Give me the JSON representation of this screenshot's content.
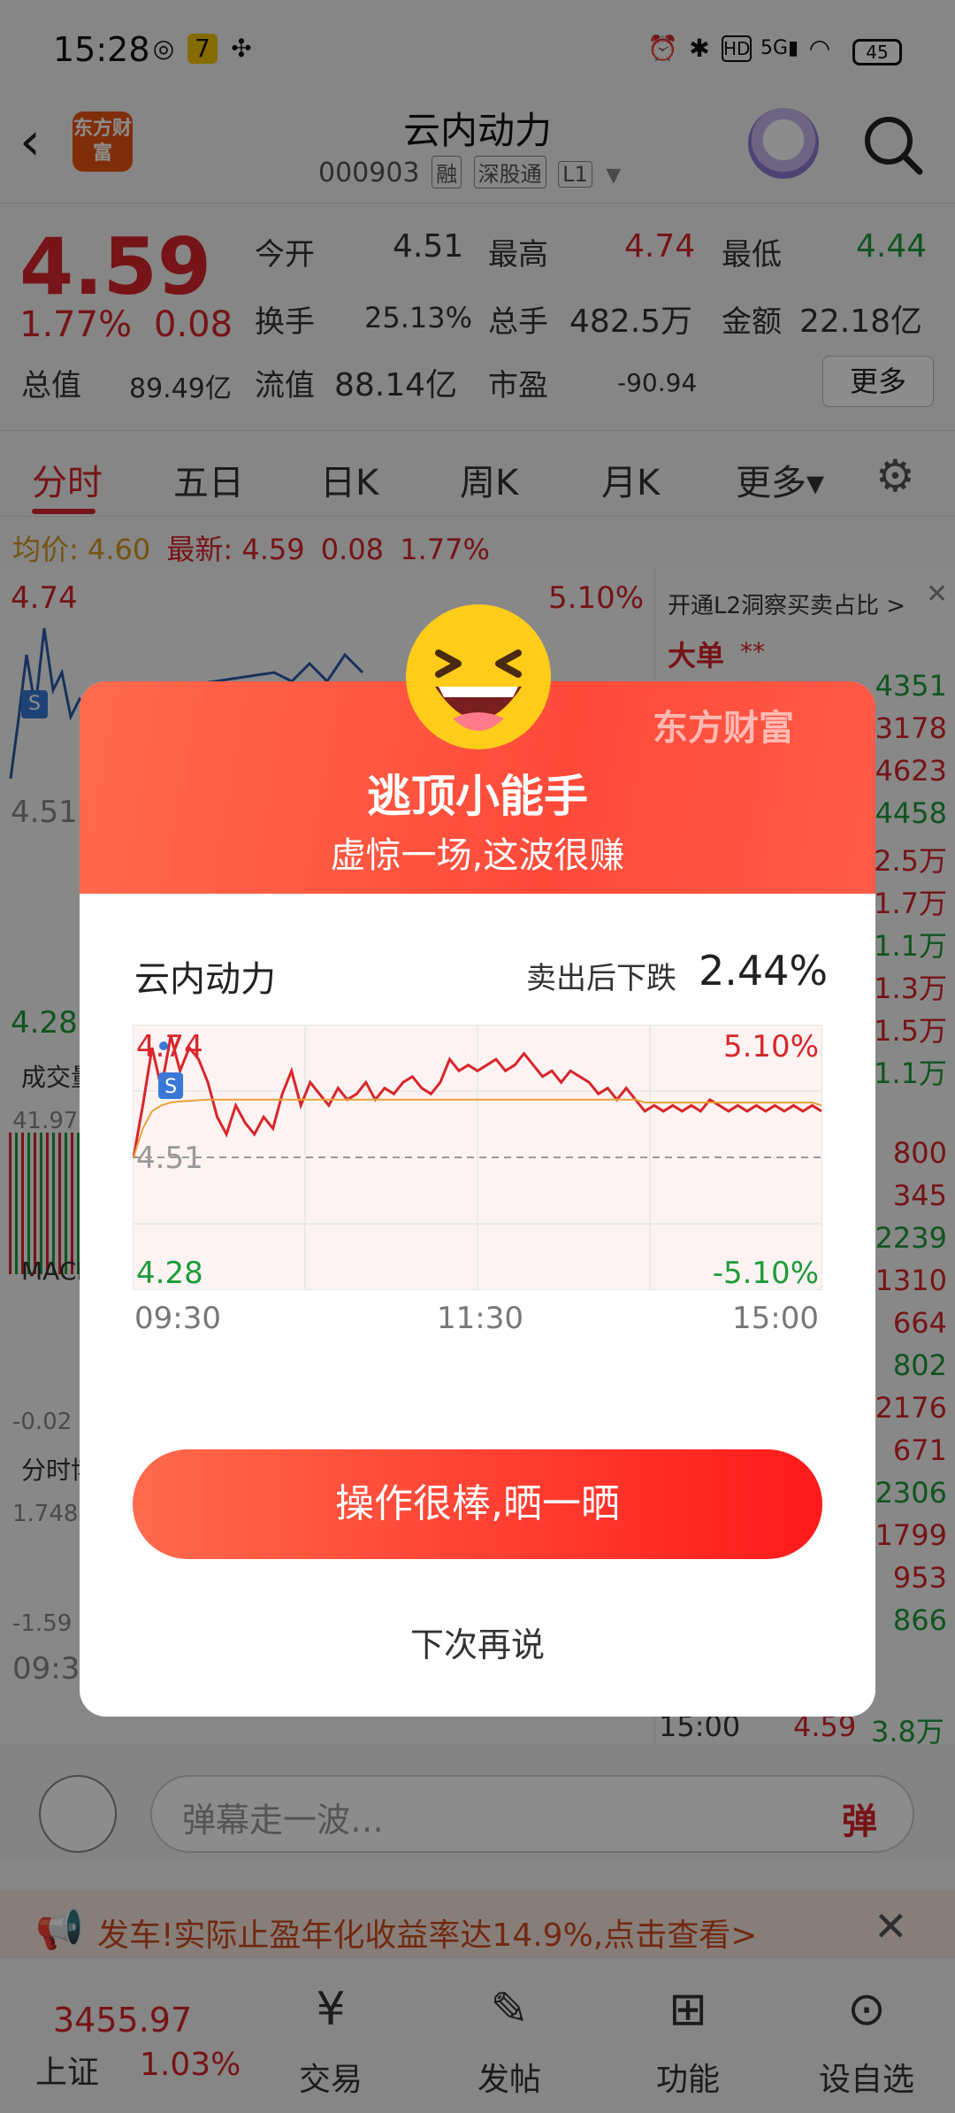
{
  "status_bar": {
    "time": "15:28",
    "battery": "45"
  },
  "header": {
    "logo_text": "东方财富",
    "name": "云内动力",
    "code": "000903",
    "tags": [
      "融",
      "深股通",
      "L1"
    ]
  },
  "quote": {
    "price": "4.59",
    "change_pct": "1.77%",
    "change": "0.08",
    "fields": [
      {
        "label": "今开",
        "value": "4.51",
        "color": "#333333"
      },
      {
        "label": "最高",
        "value": "4.74",
        "color": "#d8262a"
      },
      {
        "label": "最低",
        "value": "4.44",
        "color": "#1e9b3a"
      },
      {
        "label": "换手",
        "value": "25.13%",
        "color": "#333333"
      },
      {
        "label": "总手",
        "value": "482.5万",
        "color": "#333333"
      },
      {
        "label": "金额",
        "value": "22.18亿",
        "color": "#333333"
      },
      {
        "label": "总值",
        "value": "89.49亿",
        "color": "#333333"
      },
      {
        "label": "流值",
        "value": "88.14亿",
        "color": "#333333"
      },
      {
        "label": "市盈",
        "value": "-90.94",
        "color": "#333333"
      }
    ],
    "more_label": "更多"
  },
  "tabs": [
    "分时",
    "五日",
    "日K",
    "周K",
    "月K",
    "更多▾"
  ],
  "avg_line": {
    "avg_label": "均价:",
    "avg": "4.60",
    "last_label": "最新:",
    "last": "4.59",
    "chg": "0.08",
    "pct": "1.77%"
  },
  "background": {
    "chart_top_left": "4.74",
    "chart_top_right": "5.10%",
    "chart_mid": "4.51",
    "chart_bottom": "4.28",
    "panel_labels": [
      "成交量",
      "41.97",
      "MACD",
      "-0.02",
      "分时博弈",
      "1.748",
      "-1.59",
      "09:3"
    ],
    "l2_text": "开通L2洞察买卖占比 >",
    "big_order_label": "大单",
    "big_order_value": "**",
    "right_numbers": [
      "4351",
      "3178",
      "4623",
      "4458",
      "2.5万",
      "1.7万",
      "1.1万",
      "1.3万",
      "1.5万",
      "1.1万",
      "800",
      "345",
      "2239",
      "1310",
      "664",
      "802",
      "2176",
      "671",
      "2306",
      "1799",
      "953",
      "866"
    ],
    "last_row": {
      "time": "15:00",
      "price": "4.59",
      "vol": "3.8万"
    }
  },
  "danmu": {
    "placeholder": "弹幕走一波…",
    "button": "弹"
  },
  "ad": {
    "text": "发车!实际止盈年化收益率达14.9%,点击查看>",
    "close": "✕"
  },
  "bottom_nav": {
    "index_value": "3455.97",
    "index_name": "上证",
    "index_pct": "1.03%",
    "items": [
      "交易",
      "发帖",
      "功能",
      "设自选"
    ]
  },
  "modal": {
    "brand": "东方财富",
    "title": "逃顶小能手",
    "subtitle": "虚惊一场,这波很赚",
    "stock_name": "云内动力",
    "drop_label": "卖出后下跌",
    "drop_value": "2.44%",
    "share_button": "操作很棒,晒一晒",
    "later": "下次再说"
  },
  "chart_data": {
    "type": "line",
    "title": "",
    "x_ticks": [
      "09:30",
      "11:30",
      "15:00"
    ],
    "ylim": [
      4.28,
      4.74
    ],
    "y_labels": {
      "top": "4.74",
      "mid": "4.51",
      "bottom": "4.28",
      "top_pct": "5.10%",
      "bottom_pct": "-5.10%"
    },
    "reference": 4.51,
    "series": [
      {
        "values": [
          4.51,
          4.6,
          4.7,
          4.63,
          4.72,
          4.66,
          4.7,
          4.68,
          4.64,
          4.58,
          4.55,
          4.6,
          4.57,
          4.55,
          4.58,
          4.56,
          4.62,
          4.66,
          4.6,
          4.64,
          4.62,
          4.6,
          4.63,
          4.61,
          4.62,
          4.64,
          4.61,
          4.63,
          4.62,
          4.64,
          4.65,
          4.63,
          4.62,
          4.64,
          4.68,
          4.66,
          4.67,
          4.66,
          4.67,
          4.68,
          4.66,
          4.67,
          4.69,
          4.67,
          4.65,
          4.66,
          4.64,
          4.66,
          4.65,
          4.64,
          4.62,
          4.63,
          4.61,
          4.63,
          4.61,
          4.59,
          4.6,
          4.59,
          4.6,
          4.59,
          4.6,
          4.59,
          4.61,
          4.6,
          4.59,
          4.6,
          4.59,
          4.6,
          4.59,
          4.6,
          4.59,
          4.6,
          4.59,
          4.6,
          4.59
        ]
      },
      {
        "values": [
          4.51,
          4.56,
          4.59,
          4.6,
          4.605,
          4.607,
          4.608,
          4.609,
          4.61,
          4.61,
          4.61,
          4.61,
          4.61,
          4.61,
          4.61,
          4.61,
          4.61,
          4.61,
          4.61,
          4.61,
          4.61,
          4.61,
          4.61,
          4.61,
          4.61,
          4.61,
          4.61,
          4.61,
          4.61,
          4.61,
          4.61,
          4.61,
          4.61,
          4.61,
          4.61,
          4.61,
          4.61,
          4.61,
          4.61,
          4.61,
          4.61,
          4.61,
          4.61,
          4.61,
          4.61,
          4.61,
          4.61,
          4.61,
          4.61,
          4.61,
          4.61,
          4.61,
          4.61,
          4.61,
          4.61,
          4.605,
          4.605,
          4.605,
          4.605,
          4.605,
          4.605,
          4.605,
          4.605,
          4.605,
          4.605,
          4.605,
          4.605,
          4.605,
          4.605,
          4.605,
          4.605,
          4.605,
          4.605,
          4.605,
          4.6
        ]
      }
    ],
    "colors": {
      "price": "#d8262a",
      "avg": "#e8a33a"
    },
    "grid": true
  }
}
